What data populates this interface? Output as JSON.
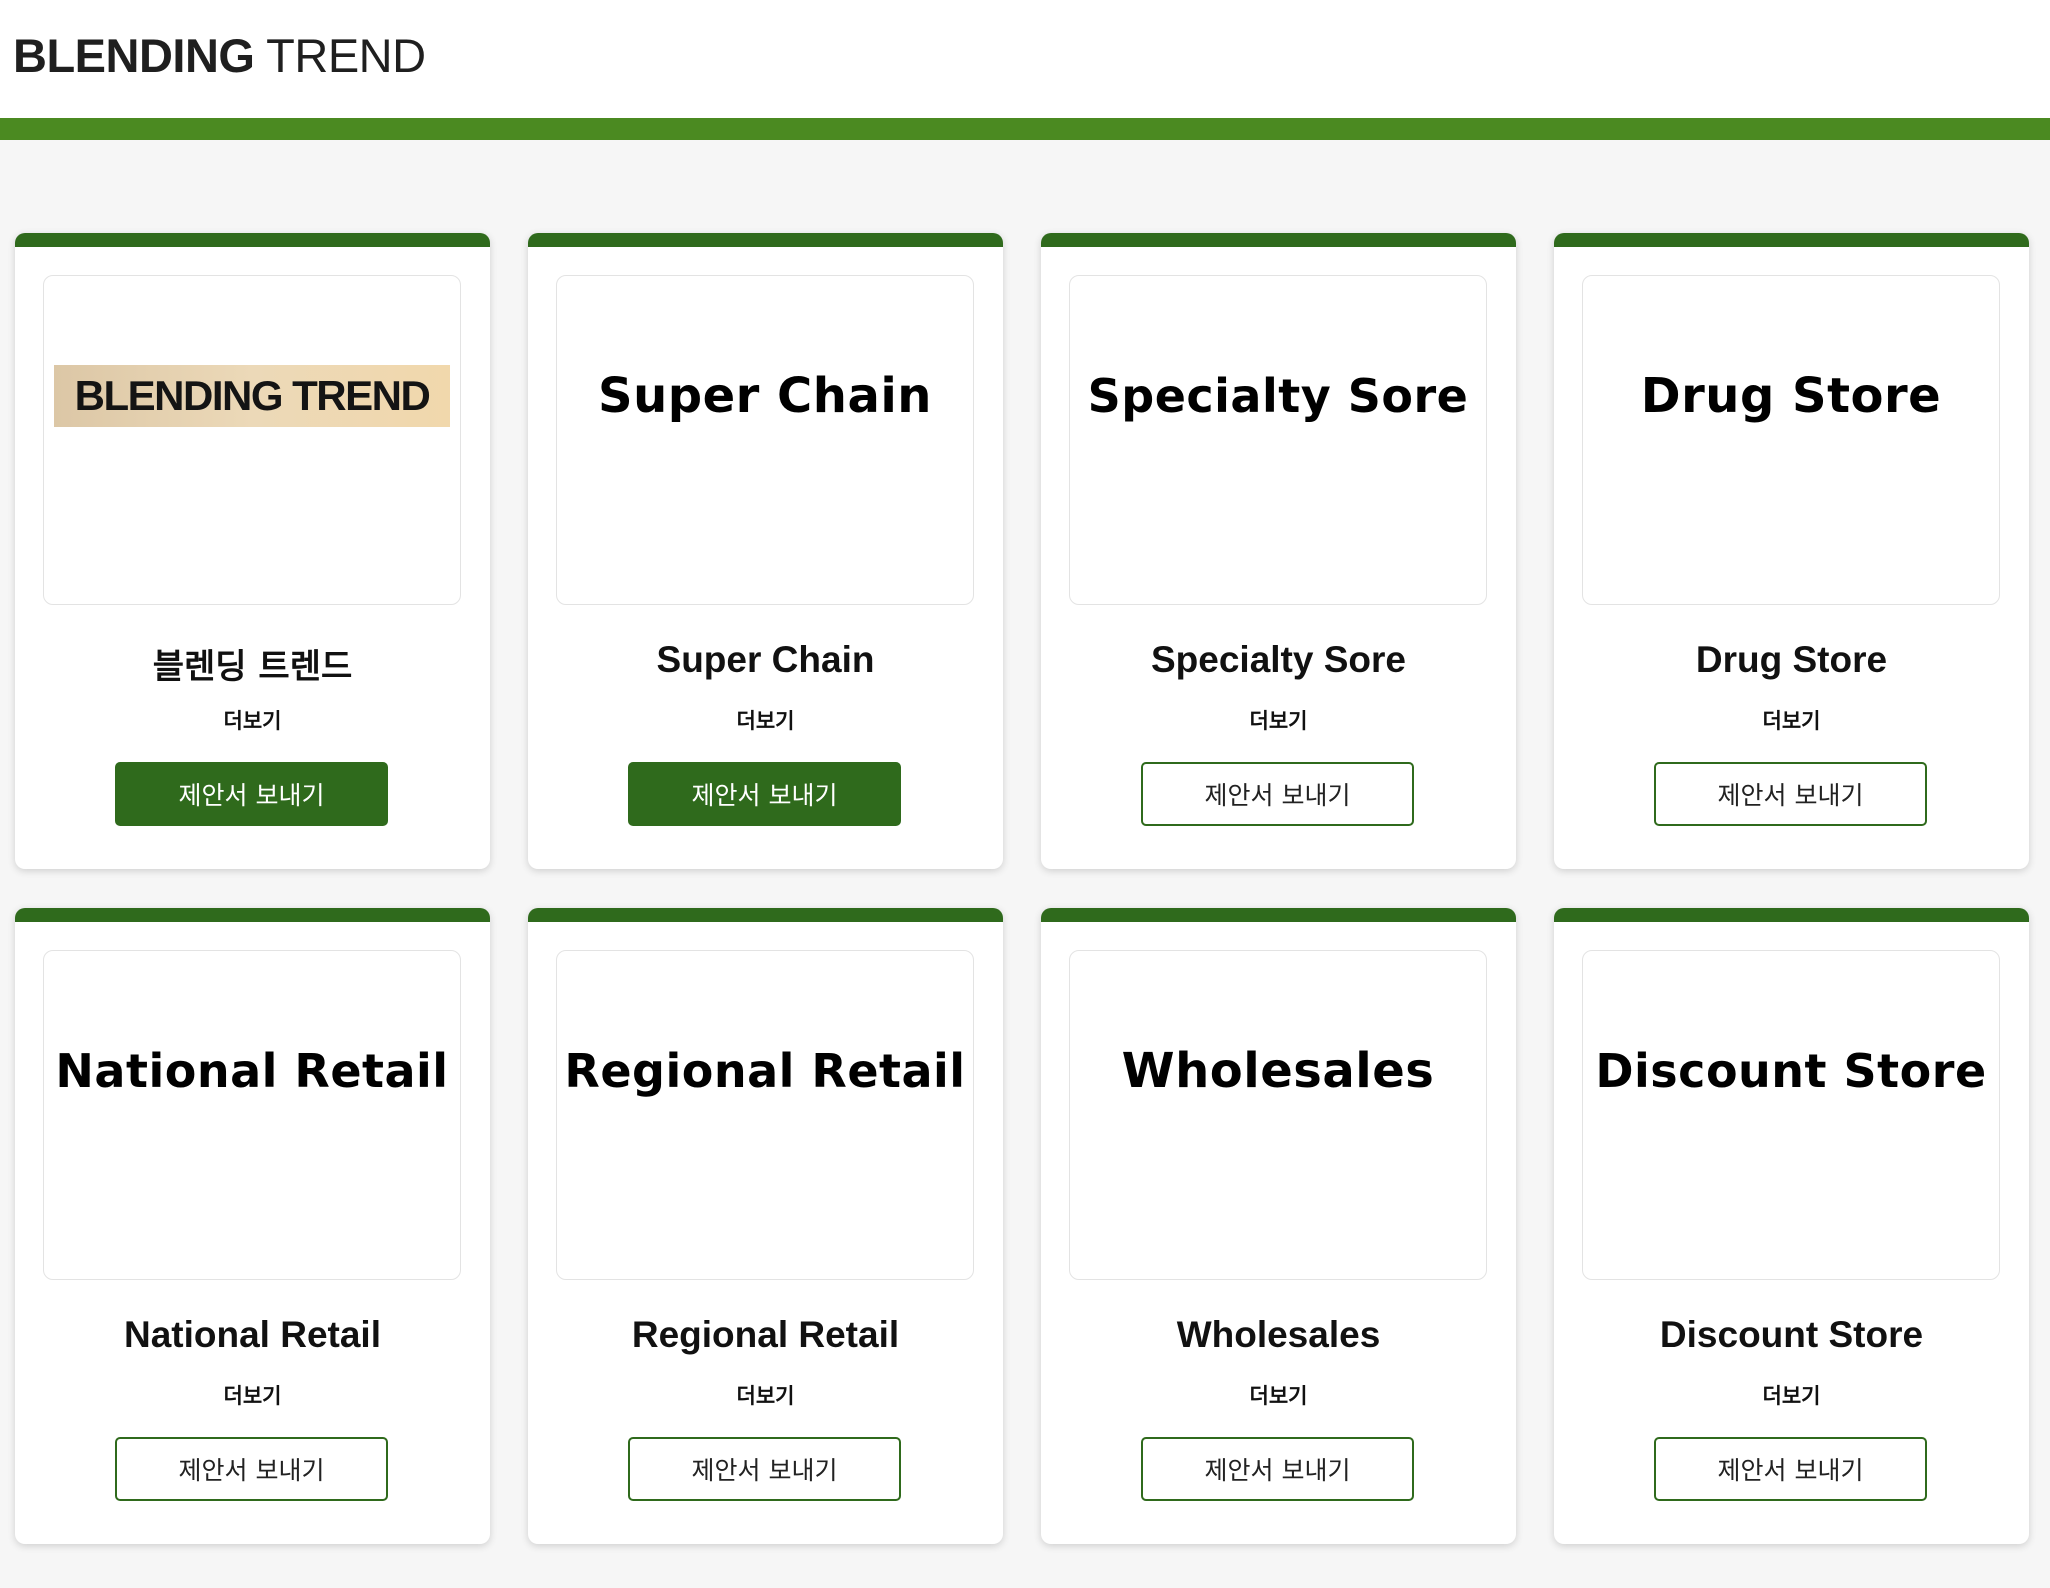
{
  "header": {
    "logo_bold": "BLENDING",
    "logo_thin": "TREND",
    "accent_color": "#4b8a21"
  },
  "cards": [
    {
      "thumb_text": "BLENDING TREND",
      "title": "블렌딩 트렌드",
      "more": "더보기",
      "button": "제안서 보내기",
      "button_style": "filled"
    },
    {
      "thumb_text": "Super Chain",
      "title": "Super Chain",
      "more": "더보기",
      "button": "제안서 보내기",
      "button_style": "filled"
    },
    {
      "thumb_text": "Specialty Sore",
      "title": "Specialty Sore",
      "more": "더보기",
      "button": "제안서 보내기",
      "button_style": "outline"
    },
    {
      "thumb_text": "Drug Store",
      "title": "Drug Store",
      "more": "더보기",
      "button": "제안서 보내기",
      "button_style": "outline"
    },
    {
      "thumb_text": "National Retail",
      "title": "National Retail",
      "more": "더보기",
      "button": "제안서 보내기",
      "button_style": "outline"
    },
    {
      "thumb_text": "Regional Retail",
      "title": "Regional Retail",
      "more": "더보기",
      "button": "제안서 보내기",
      "button_style": "outline"
    },
    {
      "thumb_text": "Wholesales",
      "title": "Wholesales",
      "more": "더보기",
      "button": "제안서 보내기",
      "button_style": "outline"
    },
    {
      "thumb_text": "Discount Store",
      "title": "Discount Store",
      "more": "더보기",
      "button": "제안서 보내기",
      "button_style": "outline"
    }
  ],
  "colors": {
    "card_top": "#2f6a1c",
    "button_green": "#2f6a1c",
    "page_bg": "#f6f6f6"
  }
}
